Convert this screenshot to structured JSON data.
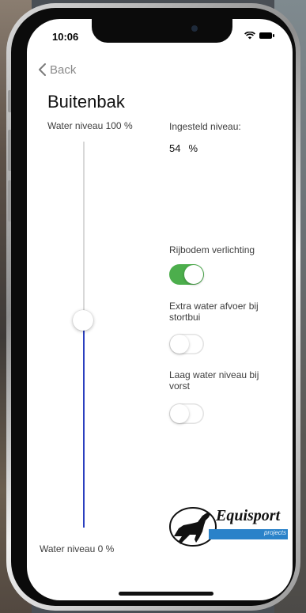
{
  "status_bar": {
    "time": "10:06"
  },
  "nav": {
    "back_label": "Back"
  },
  "page": {
    "title": "Buitenbak"
  },
  "water_slider": {
    "label_top": "Water niveau 100 %",
    "label_bottom": "Water niveau 0 %",
    "level_percent": 54,
    "track_color": "#2b3fbf"
  },
  "set_level": {
    "label": "Ingesteld niveau:",
    "value": "54",
    "unit": "%"
  },
  "options": [
    {
      "label": "Rijbodem verlichting",
      "on": true
    },
    {
      "label": "Extra water afvoer bij stortbui",
      "on": false
    },
    {
      "label": "Laag water niveau bij vorst",
      "on": false
    }
  ],
  "logo": {
    "name": "Equisport",
    "sub": "projects"
  },
  "colors": {
    "toggle_on": "#4cae4c",
    "slider_fill": "#2b3fbf"
  },
  "icons": {
    "back": "chevron-left-icon",
    "wifi": "wifi-icon",
    "battery": "battery-icon",
    "logo": "horse-icon"
  }
}
